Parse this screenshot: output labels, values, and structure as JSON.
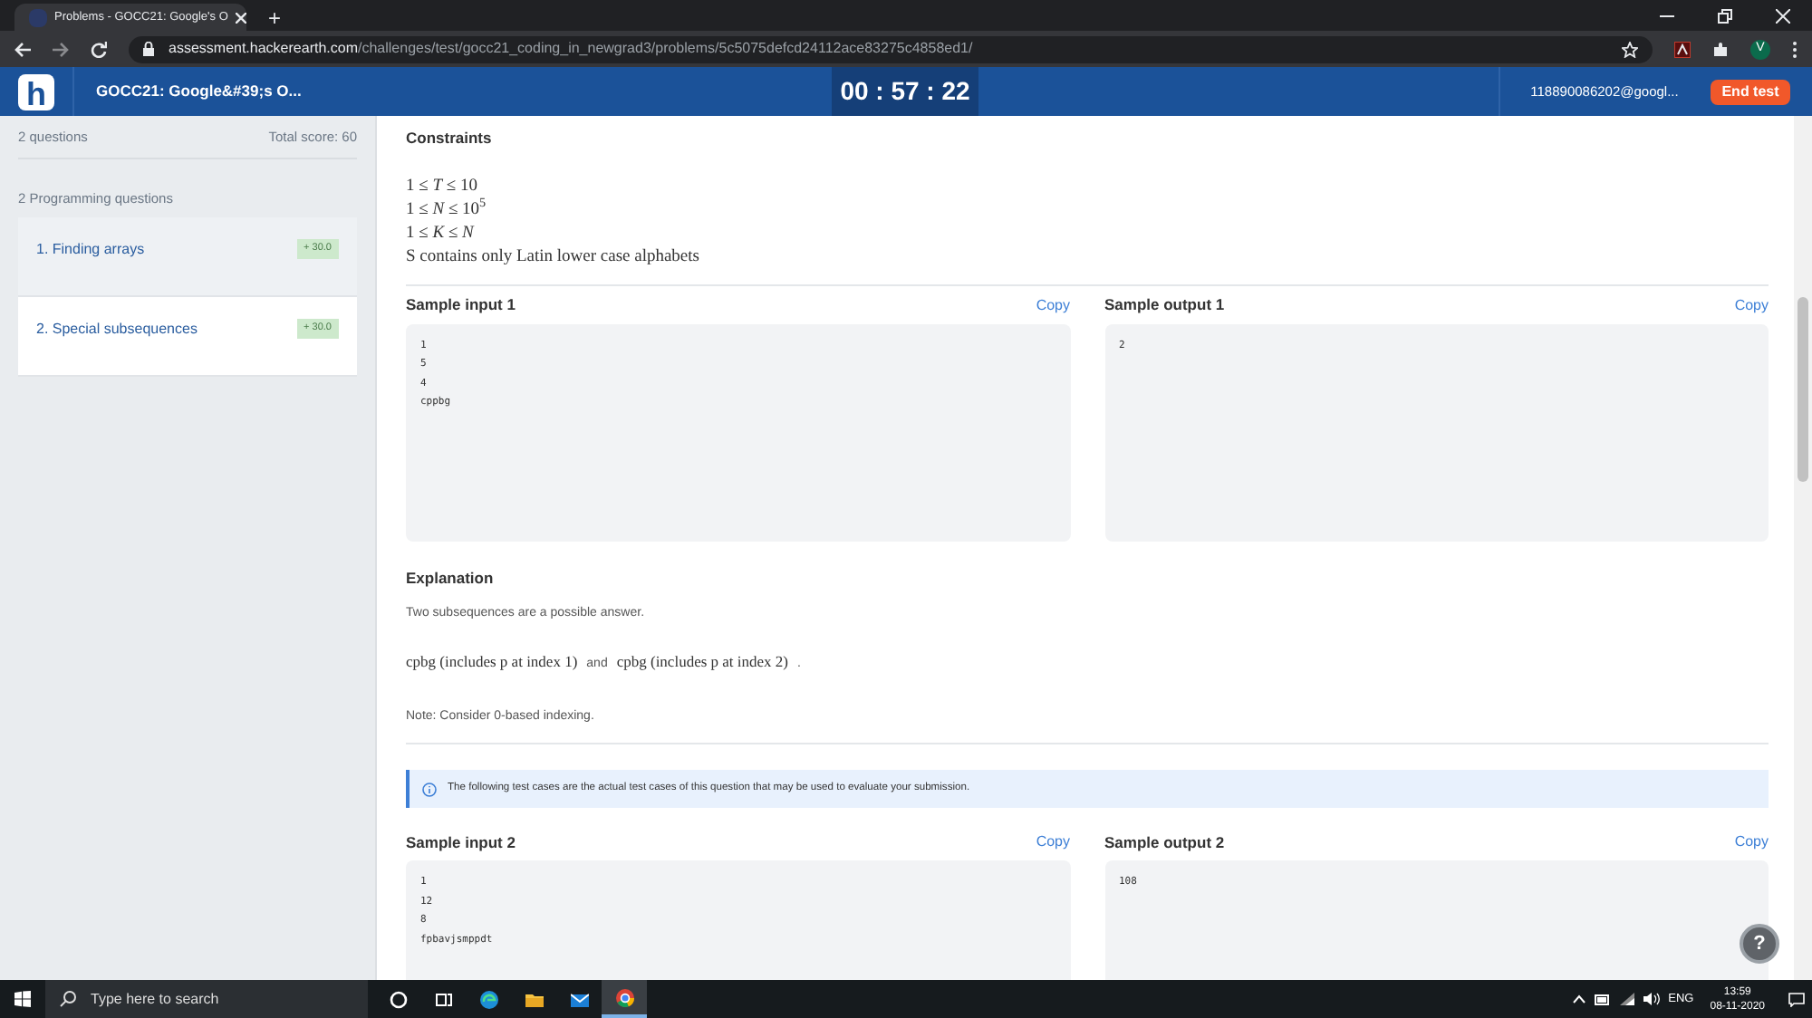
{
  "browser": {
    "tab_title": "Problems - GOCC21: Google's O",
    "new_tab": "+",
    "url_host": "assessment.hackerearth.com",
    "url_path": "/challenges/test/gocc21_coding_in_newgrad3/problems/5c5075defcd24112ace83275c4858ed1/",
    "profile": "V"
  },
  "header": {
    "logo": "h",
    "title": "GOCC21: Google&#39;s O...",
    "timer": "00 : 57 : 22",
    "user": "118890086202@googl...",
    "end_button": "End test"
  },
  "sidebar": {
    "count": "2 questions",
    "total_score": "Total score: 60",
    "section": "2 Programming questions",
    "questions": [
      {
        "number": "1.",
        "title": "Finding arrays",
        "score": "+ 30.0",
        "selected": false
      },
      {
        "number": "2.",
        "title": "Special subsequences",
        "score": "+ 30.0",
        "selected": true
      }
    ]
  },
  "problem": {
    "constraints_title": "Constraints",
    "constraints": [
      "1 ≤ *T* ≤ 10",
      "1 ≤ *N* ≤ 10$^{5}$",
      "1 ≤ *K* ≤ *N*",
      "S contains only Latin lower case alphabets"
    ],
    "sample1": {
      "input_title": "Sample input 1",
      "output_title": "Sample output 1",
      "copy_input": "Copy",
      "copy_output": "Copy",
      "input": [
        "1",
        "5",
        "4",
        "cppbg"
      ],
      "output": [
        "2"
      ]
    },
    "explanation_title": "Explanation",
    "explanation": "Two subsequences are a possible answer.",
    "math_line": [
      {
        "kind": "math",
        "text": "cpbg (includes p at index 1)"
      },
      {
        "kind": "plain",
        "text": "and"
      },
      {
        "kind": "math",
        "text": "cpbg (includes p at index 2)"
      },
      {
        "kind": "plain",
        "text": "."
      }
    ],
    "note": "Note: Consider 0-based indexing.",
    "info": "The following test cases are the actual test cases of this question that may be used to evaluate your submission.",
    "sample2": {
      "input_title": "Sample input 2",
      "output_title": "Sample output 2",
      "copy_input": "Copy",
      "copy_output": "Copy",
      "input": [
        "1",
        "12",
        "8",
        "fpbavjsmppdt"
      ],
      "output": [
        "108"
      ]
    }
  },
  "help": "?",
  "taskbar": {
    "search_placeholder": "Type here to search",
    "language": "ENG",
    "time": "13:59",
    "date": "08-11-2020"
  }
}
